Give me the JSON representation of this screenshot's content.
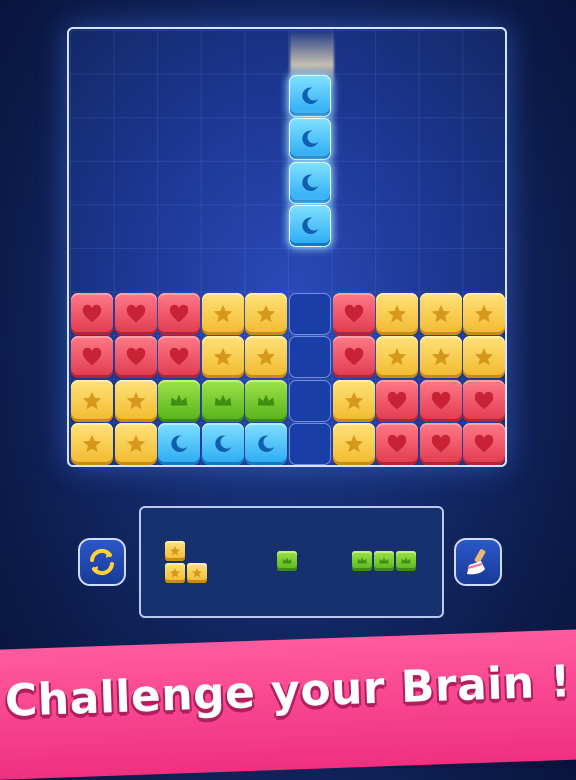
{
  "banner": {
    "text": "Challenge your Brain !"
  },
  "colors": {
    "red": "#e0394e",
    "yellow": "#f2b92c",
    "green": "#55b21a",
    "blue": "#2aa9f2",
    "banner": "#f0307f",
    "background": "#0b1a48"
  },
  "icons": {
    "red": "heart-icon",
    "yellow": "star-icon",
    "green": "crown-icon",
    "blue": "moon-icon"
  },
  "board": {
    "columns": 10,
    "rows": 10,
    "falling_piece": {
      "color": "blue",
      "column": 5,
      "rows": [
        1,
        2,
        3,
        4
      ]
    },
    "filled_rows": [
      [
        "red",
        "red",
        "red",
        "yellow",
        "yellow",
        "empty",
        "red",
        "yellow",
        "yellow",
        "yellow"
      ],
      [
        "red",
        "red",
        "red",
        "yellow",
        "yellow",
        "empty",
        "red",
        "yellow",
        "yellow",
        "yellow"
      ],
      [
        "yellow",
        "yellow",
        "green",
        "green",
        "green",
        "empty",
        "yellow",
        "red",
        "red",
        "red"
      ],
      [
        "yellow",
        "yellow",
        "blue",
        "blue",
        "blue",
        "empty",
        "yellow",
        "red",
        "red",
        "red"
      ]
    ]
  },
  "tray": {
    "pieces": [
      {
        "color": "yellow",
        "shape": "L",
        "cells": [
          [
            0,
            0
          ],
          [
            0,
            1
          ],
          [
            1,
            1
          ]
        ]
      },
      {
        "color": "green",
        "shape": "single",
        "cells": [
          [
            0,
            0
          ]
        ]
      },
      {
        "color": "green",
        "shape": "line3",
        "cells": [
          [
            0,
            0
          ],
          [
            1,
            0
          ],
          [
            2,
            0
          ]
        ]
      }
    ]
  },
  "buttons": {
    "left": "refresh-icon",
    "right": "brush-icon"
  }
}
